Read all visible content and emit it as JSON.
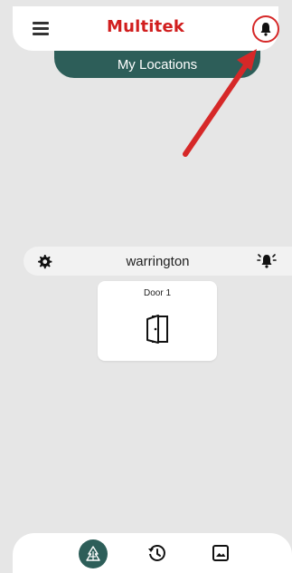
{
  "header": {
    "brand": "Multitek",
    "menu_icon": "hamburger-menu-icon",
    "notification_icon": "bell-icon",
    "highlight_color": "#d62828"
  },
  "locations_tab": {
    "label": "My Locations"
  },
  "location": {
    "name": "warrington",
    "settings_icon": "gear-icon",
    "alarm_icon": "alarm-bell-icon"
  },
  "devices": [
    {
      "label": "Door 1",
      "icon": "door-icon"
    }
  ],
  "bottom_nav": {
    "items": [
      {
        "icon": "home-tree-icon",
        "active": true
      },
      {
        "icon": "history-icon",
        "active": false
      },
      {
        "icon": "gallery-icon",
        "active": false
      }
    ]
  },
  "colors": {
    "brand_red": "#d11e1e",
    "accent_teal": "#2d5e59",
    "background": "#e6e6e6"
  }
}
